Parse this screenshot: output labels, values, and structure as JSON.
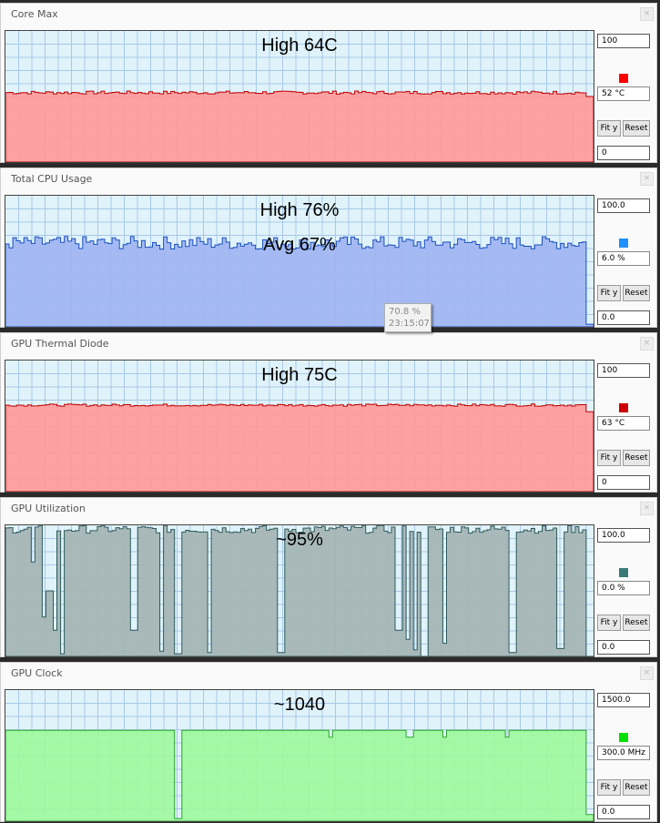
{
  "panels": [
    {
      "title": "Core Max",
      "annotations": [
        "High 64C"
      ],
      "max": "100",
      "min": "0",
      "current": "52 °C",
      "color": "#ff0000",
      "fill": "#ff9a9a",
      "line": "#c00000",
      "bg": "#e0f3fa",
      "grid": "#a8c8e8",
      "fit_label": "Fit y",
      "reset_label": "Reset",
      "level": 0.53,
      "end_level": 0.5,
      "jitter": 0.012,
      "dips": []
    },
    {
      "title": "Total CPU Usage",
      "annotations": [
        "High 76%",
        "Avg 67%"
      ],
      "max": "100.0",
      "min": "0.0",
      "current": "6.0 %",
      "color": "#1e90ff",
      "fill": "#9fb5f2",
      "line": "#1a4fbf",
      "bg": "#e0f3fa",
      "grid": "#a8c8e8",
      "fit_label": "Fit y",
      "reset_label": "Reset",
      "level": 0.64,
      "end_level": 0.02,
      "jitter": 0.05,
      "dips": []
    },
    {
      "title": "GPU Thermal Diode",
      "annotations": [
        "High 75C"
      ],
      "max": "100",
      "min": "0",
      "current": "63 °C",
      "color": "#cc0000",
      "fill": "#ff9a9a",
      "line": "#c00000",
      "bg": "#e0f3fa",
      "grid": "#a8c8e8",
      "fit_label": "Fit y",
      "reset_label": "Reset",
      "level": 0.66,
      "end_level": 0.61,
      "jitter": 0.008,
      "dips": []
    },
    {
      "title": "GPU Utilization",
      "annotations": [
        "~95%"
      ],
      "max": "100.0",
      "min": "0.0",
      "current": "0.0 %",
      "color": "#3a7a78",
      "fill": "#a4b4b4",
      "line": "#2d5a5a",
      "bg": "#e0f3fa",
      "grid": "#a8c8e8",
      "fit_label": "Fit y",
      "reset_label": "Reset",
      "level": 0.97,
      "end_level": 0.0,
      "jitter": 0.03,
      "dips": [
        [
          0.043,
          0.72
        ],
        [
          0.063,
          0.3
        ],
        [
          0.072,
          0.5
        ],
        [
          0.083,
          0.2
        ],
        [
          0.095,
          0.02
        ],
        [
          0.215,
          0.2
        ],
        [
          0.263,
          0.04
        ],
        [
          0.29,
          0.02
        ],
        [
          0.342,
          0.03
        ],
        [
          0.465,
          0.03
        ],
        [
          0.665,
          0.2
        ],
        [
          0.68,
          0.13
        ],
        [
          0.693,
          0.05
        ],
        [
          0.71,
          0.0
        ],
        [
          0.745,
          0.1
        ],
        [
          0.86,
          0.03
        ],
        [
          0.94,
          0.06
        ],
        [
          0.99,
          0.0
        ]
      ]
    },
    {
      "title": "GPU Clock",
      "annotations": [
        "~1040"
      ],
      "max": "1500.0",
      "min": "0.0",
      "current": "300.0 MHz",
      "color": "#00e000",
      "fill": "#9ef89e",
      "line": "#2aa82a",
      "bg": "#e0f3fa",
      "grid": "#a8c8e8",
      "fit_label": "Fit y",
      "reset_label": "Reset",
      "level": 0.693,
      "end_level": 0.05,
      "jitter": 0.0,
      "dips": [
        [
          0.29,
          0.02
        ],
        [
          0.55,
          0.64
        ],
        [
          0.685,
          0.64
        ],
        [
          0.745,
          0.64
        ],
        [
          0.85,
          0.64
        ]
      ]
    }
  ],
  "tooltip": {
    "value": "70.8 %",
    "time": "23:15:07"
  }
}
